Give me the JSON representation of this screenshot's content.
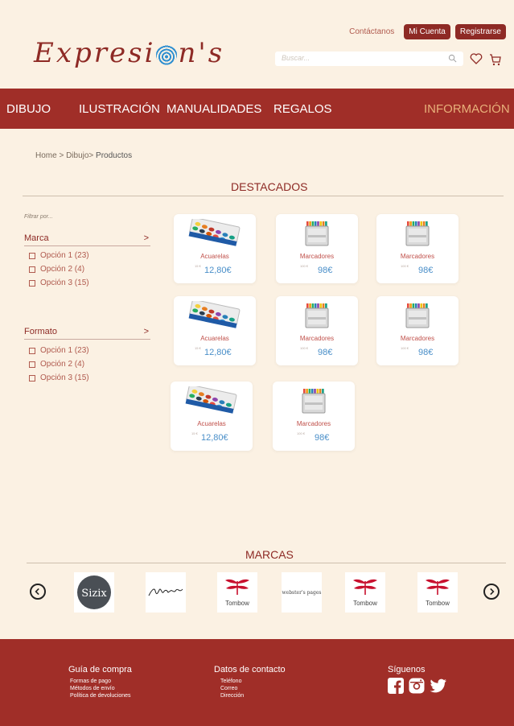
{
  "header": {
    "logo": {
      "part1": "Expresi",
      "part2": "n's"
    },
    "contact_link": "Contáctanos",
    "account_button": "Mi Cuenta",
    "register_button": "Registrarse",
    "search_placeholder": "Buscar..."
  },
  "nav": {
    "items": [
      "DIBUJO",
      "ILUSTRACIÓN",
      "MANUALIDADES",
      "REGALOS"
    ],
    "info": "INFORMACIÓN"
  },
  "breadcrumb": {
    "path": "Home > Dibujo> ",
    "current": "Productos"
  },
  "featured_title": "DESTACADOS",
  "filters": {
    "hint": "Filtrar por...",
    "groups": [
      {
        "title": "Marca",
        "chevron": ">",
        "options": [
          "Opción 1 (23)",
          "Opción 2 (4)",
          "Opción 3 (15)"
        ]
      },
      {
        "title": "Formato",
        "chevron": ">",
        "options": [
          "Opción 1 (23)",
          "Opción 2 (4)",
          "Opción 3 (15)"
        ]
      }
    ]
  },
  "products": [
    {
      "name": "Acuarelas",
      "old_price": "15 €",
      "price": "12,80€",
      "kind": "watercolor"
    },
    {
      "name": "Marcadores",
      "old_price": "100 €",
      "price": "98€",
      "kind": "markers"
    },
    {
      "name": "Marcadores",
      "old_price": "100 €",
      "price": "98€",
      "kind": "markers"
    },
    {
      "name": "Acuarelas",
      "old_price": "15 €",
      "price": "12,80€",
      "kind": "watercolor"
    },
    {
      "name": "Marcadores",
      "old_price": "100 €",
      "price": "98€",
      "kind": "markers"
    },
    {
      "name": "Marcadores",
      "old_price": "100 €",
      "price": "98€",
      "kind": "markers"
    },
    {
      "name": "Acuarelas",
      "old_price": "15 €",
      "price": "12,80€",
      "kind": "watercolor"
    },
    {
      "name": "Marcadores",
      "old_price": "100 €",
      "price": "98€",
      "kind": "markers"
    }
  ],
  "brands_title": "MARCAS",
  "brands": [
    {
      "name": "Sizzix",
      "kind": "sizzix"
    },
    {
      "name": "Tim Holtz",
      "kind": "signature"
    },
    {
      "name": "Tombow",
      "kind": "tombow"
    },
    {
      "name": "webster's pages",
      "kind": "webster"
    },
    {
      "name": "Tombow",
      "kind": "tombow"
    },
    {
      "name": "Tombow",
      "kind": "tombow"
    }
  ],
  "footer": {
    "guide": {
      "title": "Guía de compra",
      "items": [
        "Formas de pago",
        "Métodos de envío",
        "Política de devoluciones"
      ]
    },
    "contact": {
      "title": "Datos de contacto",
      "items": [
        "Teléfono",
        "Correo",
        "Dirección"
      ]
    },
    "social": {
      "title": "Síguenos",
      "icons": [
        "facebook-icon",
        "instagram-icon",
        "twitter-icon"
      ]
    }
  },
  "colors": {
    "primary": "#a02e28",
    "background": "#fbf1e3",
    "price_blue": "#4a8fc9",
    "info_gold": "#e8b07a"
  }
}
